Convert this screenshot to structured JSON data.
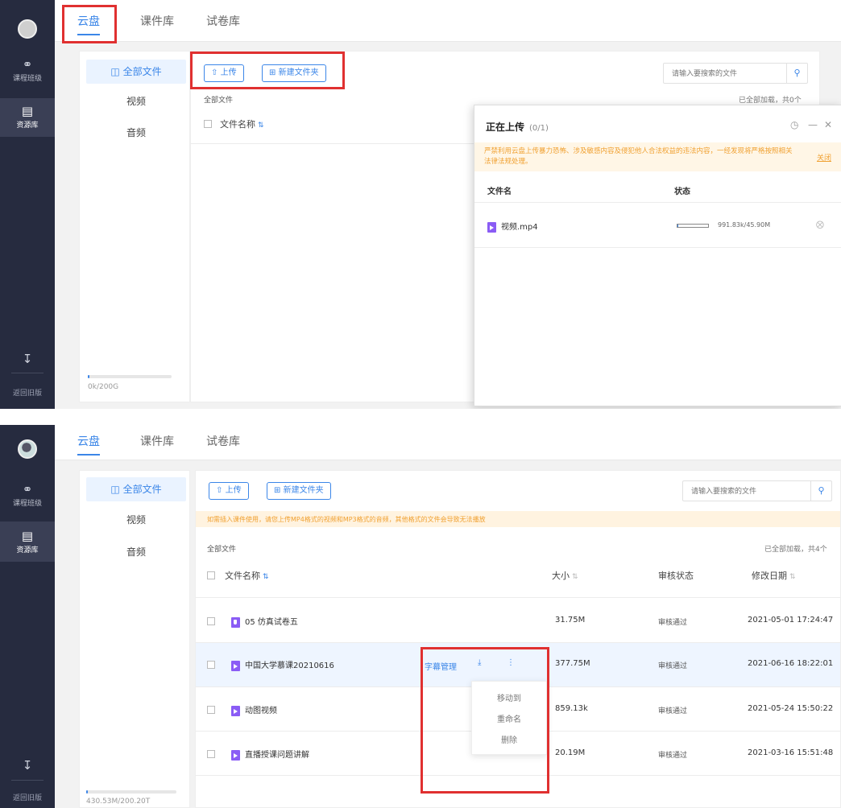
{
  "screenshot_top": {
    "rail": {
      "nav_course": "课程班级",
      "nav_resource": "资源库",
      "back_label": "返回旧版"
    },
    "tabs": [
      "云盘",
      "课件库",
      "试卷库"
    ],
    "sidebar": {
      "items": [
        "全部文件",
        "视频",
        "音频"
      ],
      "quota": "0k/200G",
      "quota_fraction": 0.01
    },
    "toolbar": {
      "upload_label": "上传",
      "new_folder_label": "新建文件夹",
      "search_placeholder": "请输入要搜索的文件"
    },
    "breadcrumb": "全部文件",
    "loaded_status": "已全部加载，共0个",
    "column_filename": "文件名称",
    "upload_popup": {
      "title": "正在上传",
      "count": "(0/1)",
      "warning": "严禁利用云盘上传暴力恐怖、涉及敏感内容及侵犯他人合法权益的违法内容，一经发现将严格按照相关法律法规处理。",
      "warning_close": "关闭",
      "col_filename": "文件名",
      "col_status": "状态",
      "file": {
        "name": "视频.mp4",
        "progress_text": "991.83k/45.90M",
        "progress_fraction": 0.02
      }
    }
  },
  "screenshot_bottom": {
    "rail": {
      "nav_course": "课程班级",
      "nav_resource": "资源库",
      "back_label": "返回旧版"
    },
    "tabs": [
      "云盘",
      "课件库",
      "试卷库"
    ],
    "sidebar": {
      "items": [
        "全部文件",
        "视频",
        "音频"
      ],
      "quota": "430.53M/200.20T",
      "quota_fraction": 0.01
    },
    "toolbar": {
      "upload_label": "上传",
      "new_folder_label": "新建文件夹",
      "search_placeholder": "请输入要搜索的文件"
    },
    "notice": "如需插入课件使用，请您上传MP4格式的视频和MP3格式的音频，其他格式的文件会导致无法播放",
    "breadcrumb": "全部文件",
    "loaded_status": "已全部加载，共4个",
    "columns": {
      "name": "文件名称",
      "size": "大小",
      "review": "审核状态",
      "modified": "修改日期"
    },
    "rows": [
      {
        "name": "05 仿真试卷五",
        "size": "31.75M",
        "review": "审核通过",
        "modified": "2021-05-01 17:24:47",
        "type": "audio"
      },
      {
        "name": "中国大学慕课20210616",
        "size": "377.75M",
        "review": "审核通过",
        "modified": "2021-06-16 18:22:01",
        "type": "video"
      },
      {
        "name": "动图视频",
        "size": "859.13k",
        "review": "审核通过",
        "modified": "2021-05-24 15:50:22",
        "type": "video"
      },
      {
        "name": "直播授课问题讲解",
        "size": "20.19M",
        "review": "审核通过",
        "modified": "2021-03-16 15:51:48",
        "type": "video"
      }
    ],
    "row_actions": {
      "subtitle": "字幕管理",
      "menu": [
        "移动到",
        "重命名",
        "删除"
      ]
    }
  }
}
